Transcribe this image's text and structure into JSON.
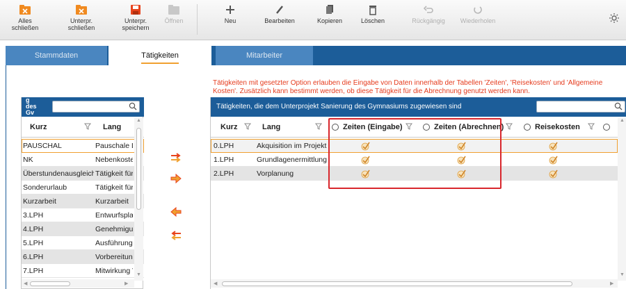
{
  "toolbar": {
    "close_all": "Alles\nschließen",
    "close_sub": "Unterpr.\nschließen",
    "save_sub": "Unterpr.\nspeichern",
    "open": "Öffnen",
    "new": "Neu",
    "edit": "Bearbeiten",
    "copy": "Kopieren",
    "delete": "Löschen",
    "undo": "Rückgängig",
    "redo": "Wiederholen"
  },
  "tabs": [
    {
      "label": "Stammdaten",
      "active": false
    },
    {
      "label": "Tätigkeiten",
      "active": true
    },
    {
      "label": "Mitarbeiter",
      "active": false
    }
  ],
  "info_text": "Tätigkeiten mit gesetzter Option erlauben die Eingabe von Daten innerhalb der Tabellen 'Zeiten', 'Reisekosten' und 'Allgemeine Kosten'. Zusätzlich kann bestimmt werden, ob diese Tätigkeit für die Abrechnung genutzt werden kann.",
  "left_panel": {
    "tag": "g\ndes\nGv",
    "search_value": "",
    "col_kurz": "Kurz",
    "col_lang": "Lang",
    "rows": [
      {
        "kurz": "PAUSCHAL",
        "lang": "Pauschale L"
      },
      {
        "kurz": "NK",
        "lang": "Nebenkoste"
      },
      {
        "kurz": "Überstundenausgleich",
        "lang": "Tätigkeit für"
      },
      {
        "kurz": "Sonderurlaub",
        "lang": "Tätigkeit für"
      },
      {
        "kurz": "Kurzarbeit",
        "lang": "Kurzarbeit"
      },
      {
        "kurz": "3.LPH",
        "lang": "Entwurfspla"
      },
      {
        "kurz": "4.LPH",
        "lang": "Genehmigu"
      },
      {
        "kurz": "5.LPH",
        "lang": "Ausführungs"
      },
      {
        "kurz": "6.LPH",
        "lang": "Vorbereitun"
      },
      {
        "kurz": "7.LPH",
        "lang": "Mitwirkung V"
      }
    ]
  },
  "right_panel": {
    "title": "Tätigkeiten, die dem Unterprojekt  Sanierung des Gymnasiums  zugewiesen sind",
    "search_value": "",
    "col_kurz": "Kurz",
    "col_lang": "Lang",
    "col_zeiten_eingabe": "Zeiten (Eingabe)",
    "col_zeiten_abrechnen": "Zeiten (Abrechnen)",
    "col_reisekosten": "Reisekosten",
    "rows": [
      {
        "kurz": "0.LPH",
        "lang": "Akquisition im Projekt",
        "eingabe": true,
        "abrechnen": true,
        "reise": true
      },
      {
        "kurz": "1.LPH",
        "lang": "Grundlagenermittlung",
        "eingabe": true,
        "abrechnen": true,
        "reise": true
      },
      {
        "kurz": "2.LPH",
        "lang": "Vorplanung",
        "eingabe": true,
        "abrechnen": true,
        "reise": true
      }
    ]
  },
  "colors": {
    "brand_blue": "#1c5d99",
    "accent_orange": "#f0a030",
    "info_red": "#e53a1c",
    "highlight_red": "#d8262c"
  }
}
